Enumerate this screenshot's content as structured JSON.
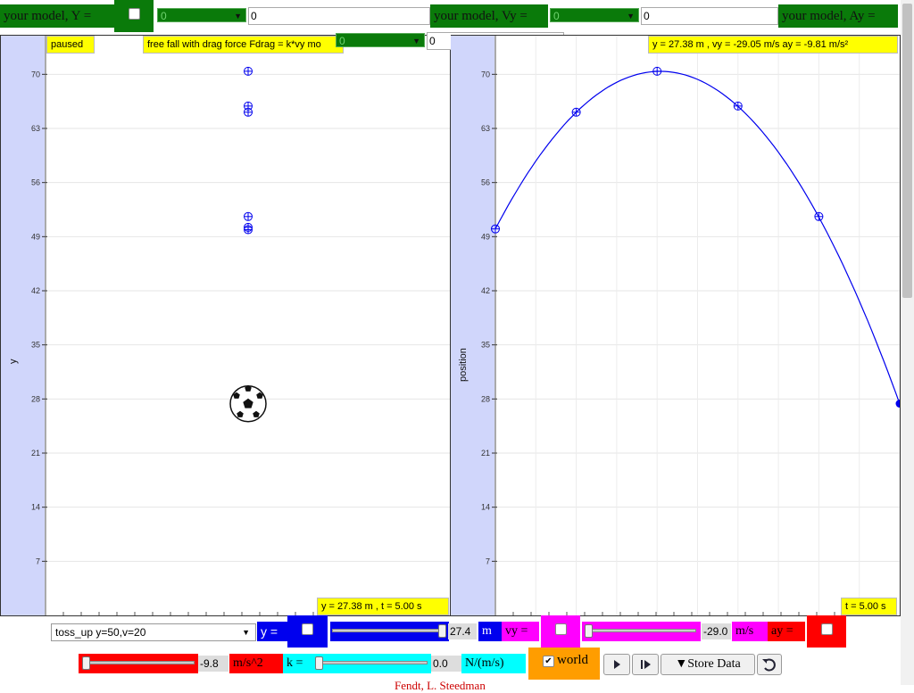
{
  "model_bar": {
    "y_label": "your model, Y =",
    "vy_label": "your model, Vy =",
    "ay_label": "your model, Ay =",
    "y_select": "0",
    "y_value": "0",
    "vy_select": "0",
    "vy_value": "0",
    "drag_select": "0",
    "drag_value": "0"
  },
  "left_plot": {
    "status": "paused",
    "title": "free fall with drag force Fdrag = k*vy mo",
    "ylabel": "y",
    "yticks": [
      "70",
      "63",
      "56",
      "49",
      "42",
      "35",
      "28",
      "21",
      "14",
      "7"
    ],
    "readout": "y = 27.38 m , t = 5.00 s"
  },
  "right_plot": {
    "ylabel": "position",
    "yticks": [
      "70",
      "63",
      "56",
      "49",
      "42",
      "35",
      "28",
      "21",
      "14",
      "7"
    ],
    "readout_top": "y = 27.38 m , vy = -29.05 m/s ay = -9.81 m/s²",
    "readout_bottom": "t = 5.00 s"
  },
  "chart_data": {
    "type": "line",
    "ylabel": "position",
    "ylim": [
      0,
      75
    ],
    "xlim": [
      0,
      5
    ],
    "x": [
      0,
      1,
      2,
      3,
      4,
      5
    ],
    "series": [
      {
        "values": [
          50,
          65.1,
          70.4,
          65.9,
          51.6,
          27.4
        ]
      }
    ],
    "left_markers_y": [
      70.4,
      65.9,
      65.1,
      51.6,
      50.2,
      49.9
    ],
    "ball_y": 27.38
  },
  "controls": {
    "scenario": "toss_up y=50,v=20",
    "y_label": "y =",
    "y_value": "27.4",
    "y_unit": "m",
    "vy_label": "vy =",
    "vy_value": "-29.0",
    "vy_unit": "m/s",
    "ay_label": "ay =",
    "ay_value": "-9.8",
    "ay_unit": "m/s^2",
    "k_label": "k =",
    "k_value": "0.0",
    "k_unit": "N/(m/s)",
    "world_label": "world",
    "store_label": "Store Data",
    "footer_text": "Fendt, L. Steedman"
  },
  "colors": {
    "model_green": "#0a7a0a",
    "axis_strip": "#d0d6fb",
    "highlight": "#ffff00",
    "plot_line": "#0000ee"
  }
}
